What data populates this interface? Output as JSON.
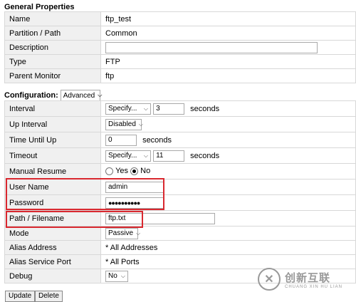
{
  "general": {
    "title": "General Properties",
    "rows": [
      {
        "label": "Name",
        "value": "ftp_test"
      },
      {
        "label": "Partition / Path",
        "value": "Common"
      },
      {
        "label": "Description",
        "value": ""
      },
      {
        "label": "Type",
        "value": "FTP"
      },
      {
        "label": "Parent Monitor",
        "value": "ftp"
      }
    ]
  },
  "config": {
    "title": "Configuration:",
    "mode_select": "Advanced",
    "interval": {
      "label": "Interval",
      "select": "Specify...",
      "value": "3",
      "unit": "seconds"
    },
    "up_interval": {
      "label": "Up Interval",
      "select": "Disabled"
    },
    "time_until_up": {
      "label": "Time Until Up",
      "value": "0",
      "unit": "seconds"
    },
    "timeout": {
      "label": "Timeout",
      "select": "Specify...",
      "value": "11",
      "unit": "seconds"
    },
    "manual_resume": {
      "label": "Manual Resume",
      "yes": "Yes",
      "no": "No",
      "selected": "No"
    },
    "user_name": {
      "label": "User Name",
      "value": "admin"
    },
    "password": {
      "label": "Password",
      "value": "●●●●●●●●●●"
    },
    "path_filename": {
      "label": "Path / Filename",
      "value": "ftp.txt"
    },
    "mode": {
      "label": "Mode",
      "select": "Passive"
    },
    "alias_address": {
      "label": "Alias Address",
      "value": "* All Addresses"
    },
    "alias_port": {
      "label": "Alias Service Port",
      "value": "* All Ports"
    },
    "debug": {
      "label": "Debug",
      "select": "No"
    }
  },
  "buttons": {
    "update": "Update",
    "delete": "Delete"
  },
  "watermark": {
    "cn": "创新互联",
    "en": "CHUANG XIN HU LIAN"
  },
  "colors": {
    "highlight": "#d9282f",
    "label_bg": "#f0f0f0"
  }
}
